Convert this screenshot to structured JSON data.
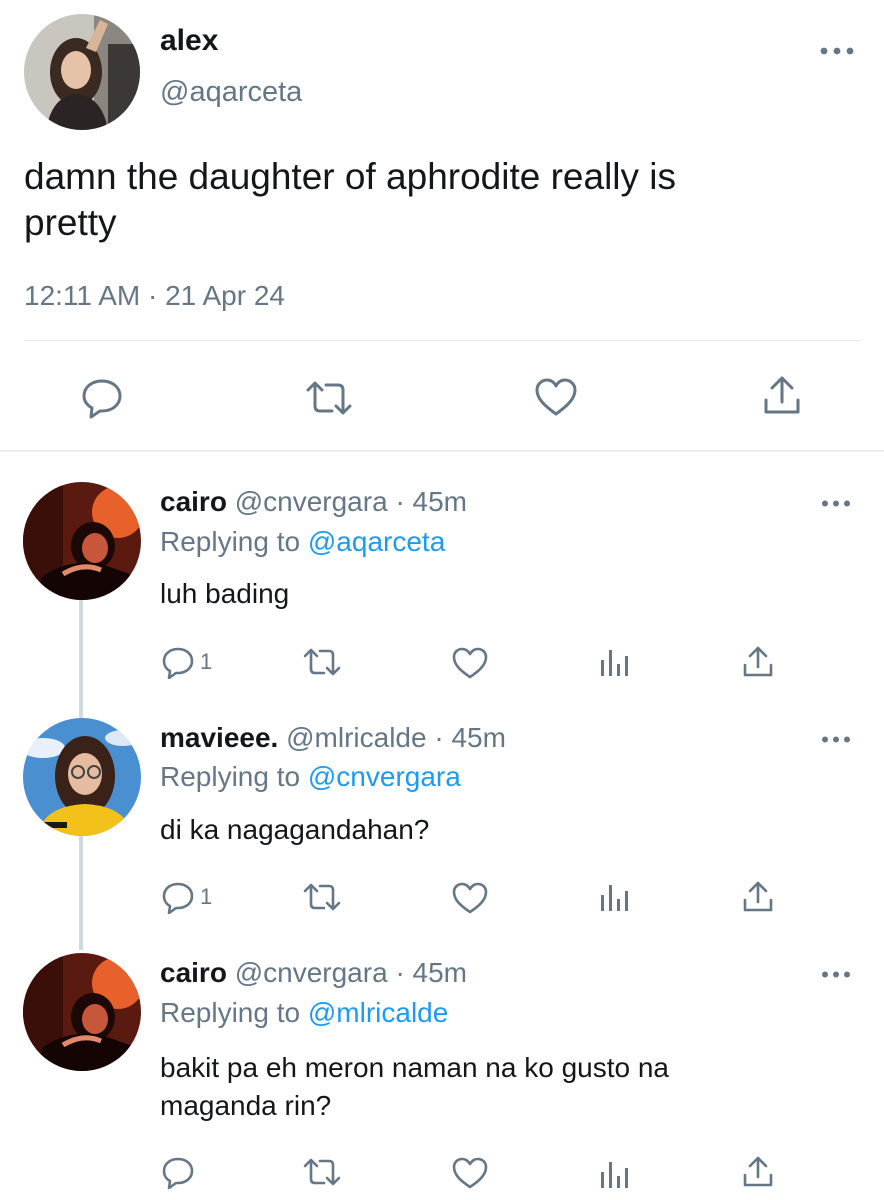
{
  "main_tweet": {
    "name": "alex",
    "handle": "@aqarceta",
    "text_line1": "damn the daughter of aphrodite really is",
    "text_line2": "pretty",
    "timestamp": "12:11 AM · 21 Apr 24",
    "icons": [
      "reply-icon",
      "retweet-icon",
      "like-icon",
      "share-icon",
      "more-icon"
    ]
  },
  "replies": [
    {
      "name": "cairo",
      "handle": "@cnvergara",
      "time": "· 45m",
      "replying_prefix": "Replying to",
      "replying_to": "@aqarceta",
      "text_line1": "luh bading",
      "text_line2": "",
      "reply_count": "1"
    },
    {
      "name": "mavieee.",
      "handle": "@mlricalde",
      "time": "· 45m",
      "replying_prefix": "Replying to",
      "replying_to": "@cnvergara",
      "text_line1": "di ka nagagandahan?",
      "text_line2": "",
      "reply_count": "1"
    },
    {
      "name": "cairo",
      "handle": "@cnvergara",
      "time": "· 45m",
      "replying_prefix": "Replying to",
      "replying_to": "@mlricalde",
      "text_line1": "bakit pa eh meron naman na ko gusto na",
      "text_line2": "maganda rin?",
      "reply_count": ""
    }
  ],
  "colors": {
    "text": "#14171a",
    "muted": "#657786",
    "link": "#1d9bf0",
    "divider": "#e1e8ed",
    "thread_line": "#cfd9de"
  }
}
